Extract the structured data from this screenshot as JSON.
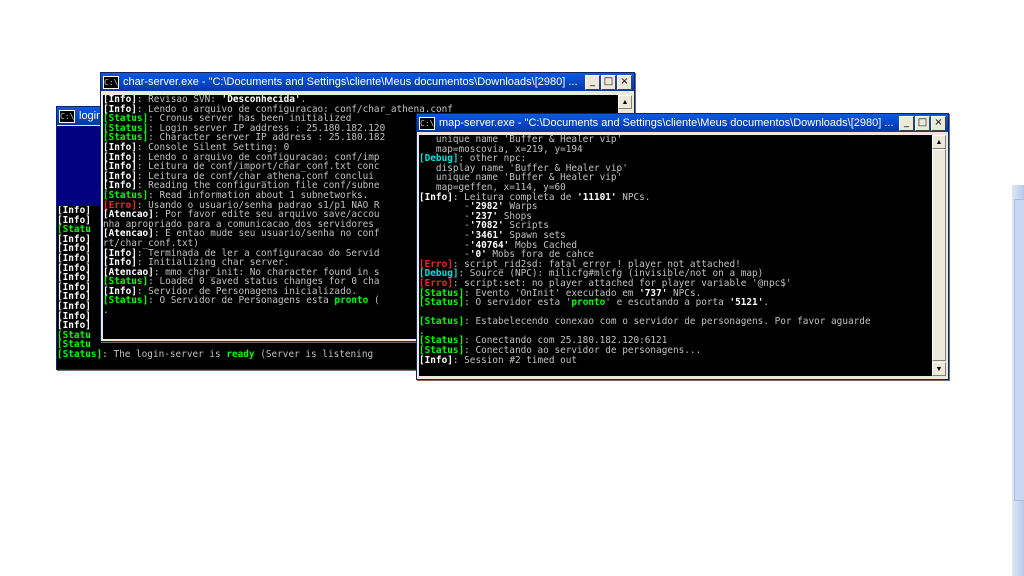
{
  "login_window": {
    "title": "login",
    "visible_lines": [
      [
        [
          "b",
          "[Info]"
        ]
      ],
      [
        [
          "b",
          "[Info]"
        ]
      ],
      [
        [
          "g",
          "[Statu"
        ]
      ],
      [
        [
          "b",
          "[Info]"
        ]
      ],
      [
        [
          "b",
          "[Info]"
        ]
      ],
      [
        [
          "b",
          "[Info]"
        ]
      ],
      [
        [
          "b",
          "[Info]"
        ]
      ],
      [
        [
          "b",
          "[Info]"
        ]
      ],
      [
        [
          "b",
          "[Info]"
        ]
      ],
      [
        [
          "b",
          "[Info]"
        ]
      ],
      [
        [
          "b",
          "[Info]"
        ]
      ],
      [
        [
          "b",
          "[Info]"
        ]
      ],
      [
        [
          "b",
          "[Info]"
        ]
      ],
      [
        [
          "g",
          "[Statu"
        ]
      ],
      [
        [
          "g",
          "[Statu"
        ]
      ]
    ],
    "bottom_line": [
      [
        "g",
        "[Status]"
      ],
      [
        "t",
        ": The login-server is "
      ],
      [
        "g",
        "ready"
      ],
      [
        "t",
        " (Server is listening"
      ]
    ]
  },
  "char_window": {
    "title": "char-server.exe - \"C:\\Documents and Settings\\cliente\\Meus documentos\\Downloads\\[2980] ...",
    "lines": [
      [
        [
          "b",
          "[Info]"
        ],
        [
          "t",
          ": Revisao SVN: "
        ],
        [
          "b",
          "'Desconhecida'"
        ],
        [
          "t",
          "."
        ]
      ],
      [
        [
          "b",
          "[Info]"
        ],
        [
          "t",
          ": Lendo o arquivo de configuracao: conf/char_athena.conf"
        ]
      ],
      [
        [
          "g",
          "[Status]"
        ],
        [
          "t",
          ": Cronus server has been initialized"
        ]
      ],
      [
        [
          "g",
          "[Status]"
        ],
        [
          "t",
          ": Login server IP address : 25.180.182.120"
        ]
      ],
      [
        [
          "g",
          "[Status]"
        ],
        [
          "t",
          ": Character server IP address : 25.180.182"
        ]
      ],
      [
        [
          "b",
          "[Info]"
        ],
        [
          "t",
          ": Console Silent Setting: 0"
        ]
      ],
      [
        [
          "b",
          "[Info]"
        ],
        [
          "t",
          ": Lendo o arquivo de configuracao: conf/imp"
        ]
      ],
      [
        [
          "b",
          "[Info]"
        ],
        [
          "t",
          ": Leitura de conf/import/char_conf.txt conc"
        ]
      ],
      [
        [
          "b",
          "[Info]"
        ],
        [
          "t",
          ": Leitura de conf/char_athena.conf conclui"
        ]
      ],
      [
        [
          "b",
          "[Info]"
        ],
        [
          "t",
          ": Reading the configuration file conf/subne"
        ]
      ],
      [
        [
          "g",
          "[Status]"
        ],
        [
          "t",
          ": Read information about 1 subnetworks."
        ]
      ],
      [
        [
          "r",
          "[Erro]"
        ],
        [
          "t",
          ": Usando o usuario/senha padrao s1/p1 NAO R"
        ]
      ],
      [
        [
          "b",
          "[Atencao]"
        ],
        [
          "t",
          ": Por favor edite seu arquivo save/accou"
        ]
      ],
      [
        [
          "t",
          "nha apropriado para a comunicacao dos servidores"
        ]
      ],
      [
        [
          "b",
          "[Atencao]"
        ],
        [
          "t",
          ": E entao mude seu usuario/senha no conf"
        ]
      ],
      [
        [
          "t",
          "rt/char_conf.txt)"
        ]
      ],
      [
        [
          "b",
          "[Info]"
        ],
        [
          "t",
          ": Terminada de ler a configuracao do Servid"
        ]
      ],
      [
        [
          "b",
          "[Info]"
        ],
        [
          "t",
          ": Initializing char server."
        ]
      ],
      [
        [
          "b",
          "[Atencao]"
        ],
        [
          "t",
          ": mmo_char_init: No character found in s"
        ]
      ],
      [
        [
          "g",
          "[Status]"
        ],
        [
          "t",
          ": Loaded 0 saved status changes for 0 cha"
        ]
      ],
      [
        [
          "b",
          "[Info]"
        ],
        [
          "t",
          ": Servidor de Personagens inicializado."
        ]
      ],
      [
        [
          "g",
          "[Status]"
        ],
        [
          "t",
          ": O Servidor de Personagens esta "
        ],
        [
          "g",
          "pronto"
        ],
        [
          "t",
          " ("
        ]
      ],
      [
        [
          "t",
          "."
        ]
      ]
    ]
  },
  "map_window": {
    "title": "map-server.exe - \"C:\\Documents and Settings\\cliente\\Meus documentos\\Downloads\\[2980] ...",
    "lines": [
      [
        [
          "t",
          "   unique name 'Buffer & Healer vip'"
        ]
      ],
      [
        [
          "t",
          "   map=moscovia, x=219, y=194"
        ]
      ],
      [
        [
          "c",
          "[Debug]"
        ],
        [
          "t",
          ": other npc:"
        ]
      ],
      [
        [
          "t",
          "   display name 'Buffer & Healer vip'"
        ]
      ],
      [
        [
          "t",
          "   unique name 'Buffer & Healer vip'"
        ]
      ],
      [
        [
          "t",
          "   map=geffen, x=114, y=60"
        ]
      ],
      [
        [
          "b",
          "[Info]"
        ],
        [
          "t",
          ": Leitura completa de "
        ],
        [
          "b",
          "'11101'"
        ],
        [
          "t",
          " NPCs."
        ]
      ],
      [
        [
          "t",
          "        -"
        ],
        [
          "b",
          "'2982'"
        ],
        [
          "t",
          " Warps"
        ]
      ],
      [
        [
          "t",
          "        -"
        ],
        [
          "b",
          "'237'"
        ],
        [
          "t",
          " Shops"
        ]
      ],
      [
        [
          "t",
          "        -"
        ],
        [
          "b",
          "'7082'"
        ],
        [
          "t",
          " Scripts"
        ]
      ],
      [
        [
          "t",
          "        -"
        ],
        [
          "b",
          "'3461'"
        ],
        [
          "t",
          " Spawn sets"
        ]
      ],
      [
        [
          "t",
          "        -"
        ],
        [
          "b",
          "'40764'"
        ],
        [
          "t",
          " Mobs Cached"
        ]
      ],
      [
        [
          "t",
          "        -"
        ],
        [
          "b",
          "'0'"
        ],
        [
          "t",
          " Mobs fora de cahce"
        ]
      ],
      [
        [
          "r",
          "[Erro]"
        ],
        [
          "t",
          ": script_rid2sd: fatal error ! player not attached!"
        ]
      ],
      [
        [
          "c",
          "[Debug]"
        ],
        [
          "t",
          ": Source (NPC): milicfg#mlcfg (invisible/not on a map)"
        ]
      ],
      [
        [
          "r",
          "[Erro]"
        ],
        [
          "t",
          ": script:set: no player attached for player variable '@npc$'"
        ]
      ],
      [
        [
          "g",
          "[Status]"
        ],
        [
          "t",
          ": Evento 'OnInit' executado em "
        ],
        [
          "b",
          "'737'"
        ],
        [
          "t",
          " NPCs."
        ]
      ],
      [
        [
          "g",
          "[Status]"
        ],
        [
          "t",
          ": O servidor esta '"
        ],
        [
          "g",
          "pronto"
        ],
        [
          "t",
          "' e escutando a porta "
        ],
        [
          "b",
          "'5121'"
        ],
        [
          "t",
          "."
        ]
      ],
      [
        [
          "t",
          ""
        ]
      ],
      [
        [
          "g",
          "[Status]"
        ],
        [
          "t",
          ": Estabelecendo conexao com o servidor de personagens. Por favor aguarde"
        ]
      ],
      [
        [
          "t",
          "."
        ]
      ],
      [
        [
          "g",
          "[Status]"
        ],
        [
          "t",
          ": Conectando com 25.180.182.120:6121"
        ]
      ],
      [
        [
          "g",
          "[Status]"
        ],
        [
          "t",
          ": Conectando ao servidor de personagens..."
        ]
      ],
      [
        [
          "b",
          "[Info]"
        ],
        [
          "t",
          ": Session #2 timed out"
        ]
      ]
    ]
  },
  "window_buttons": {
    "minimize": "_",
    "maximize": "□",
    "close": "×"
  },
  "console_icon": "C:\\",
  "scroll_arrows": {
    "up": "▲",
    "down": "▼"
  }
}
